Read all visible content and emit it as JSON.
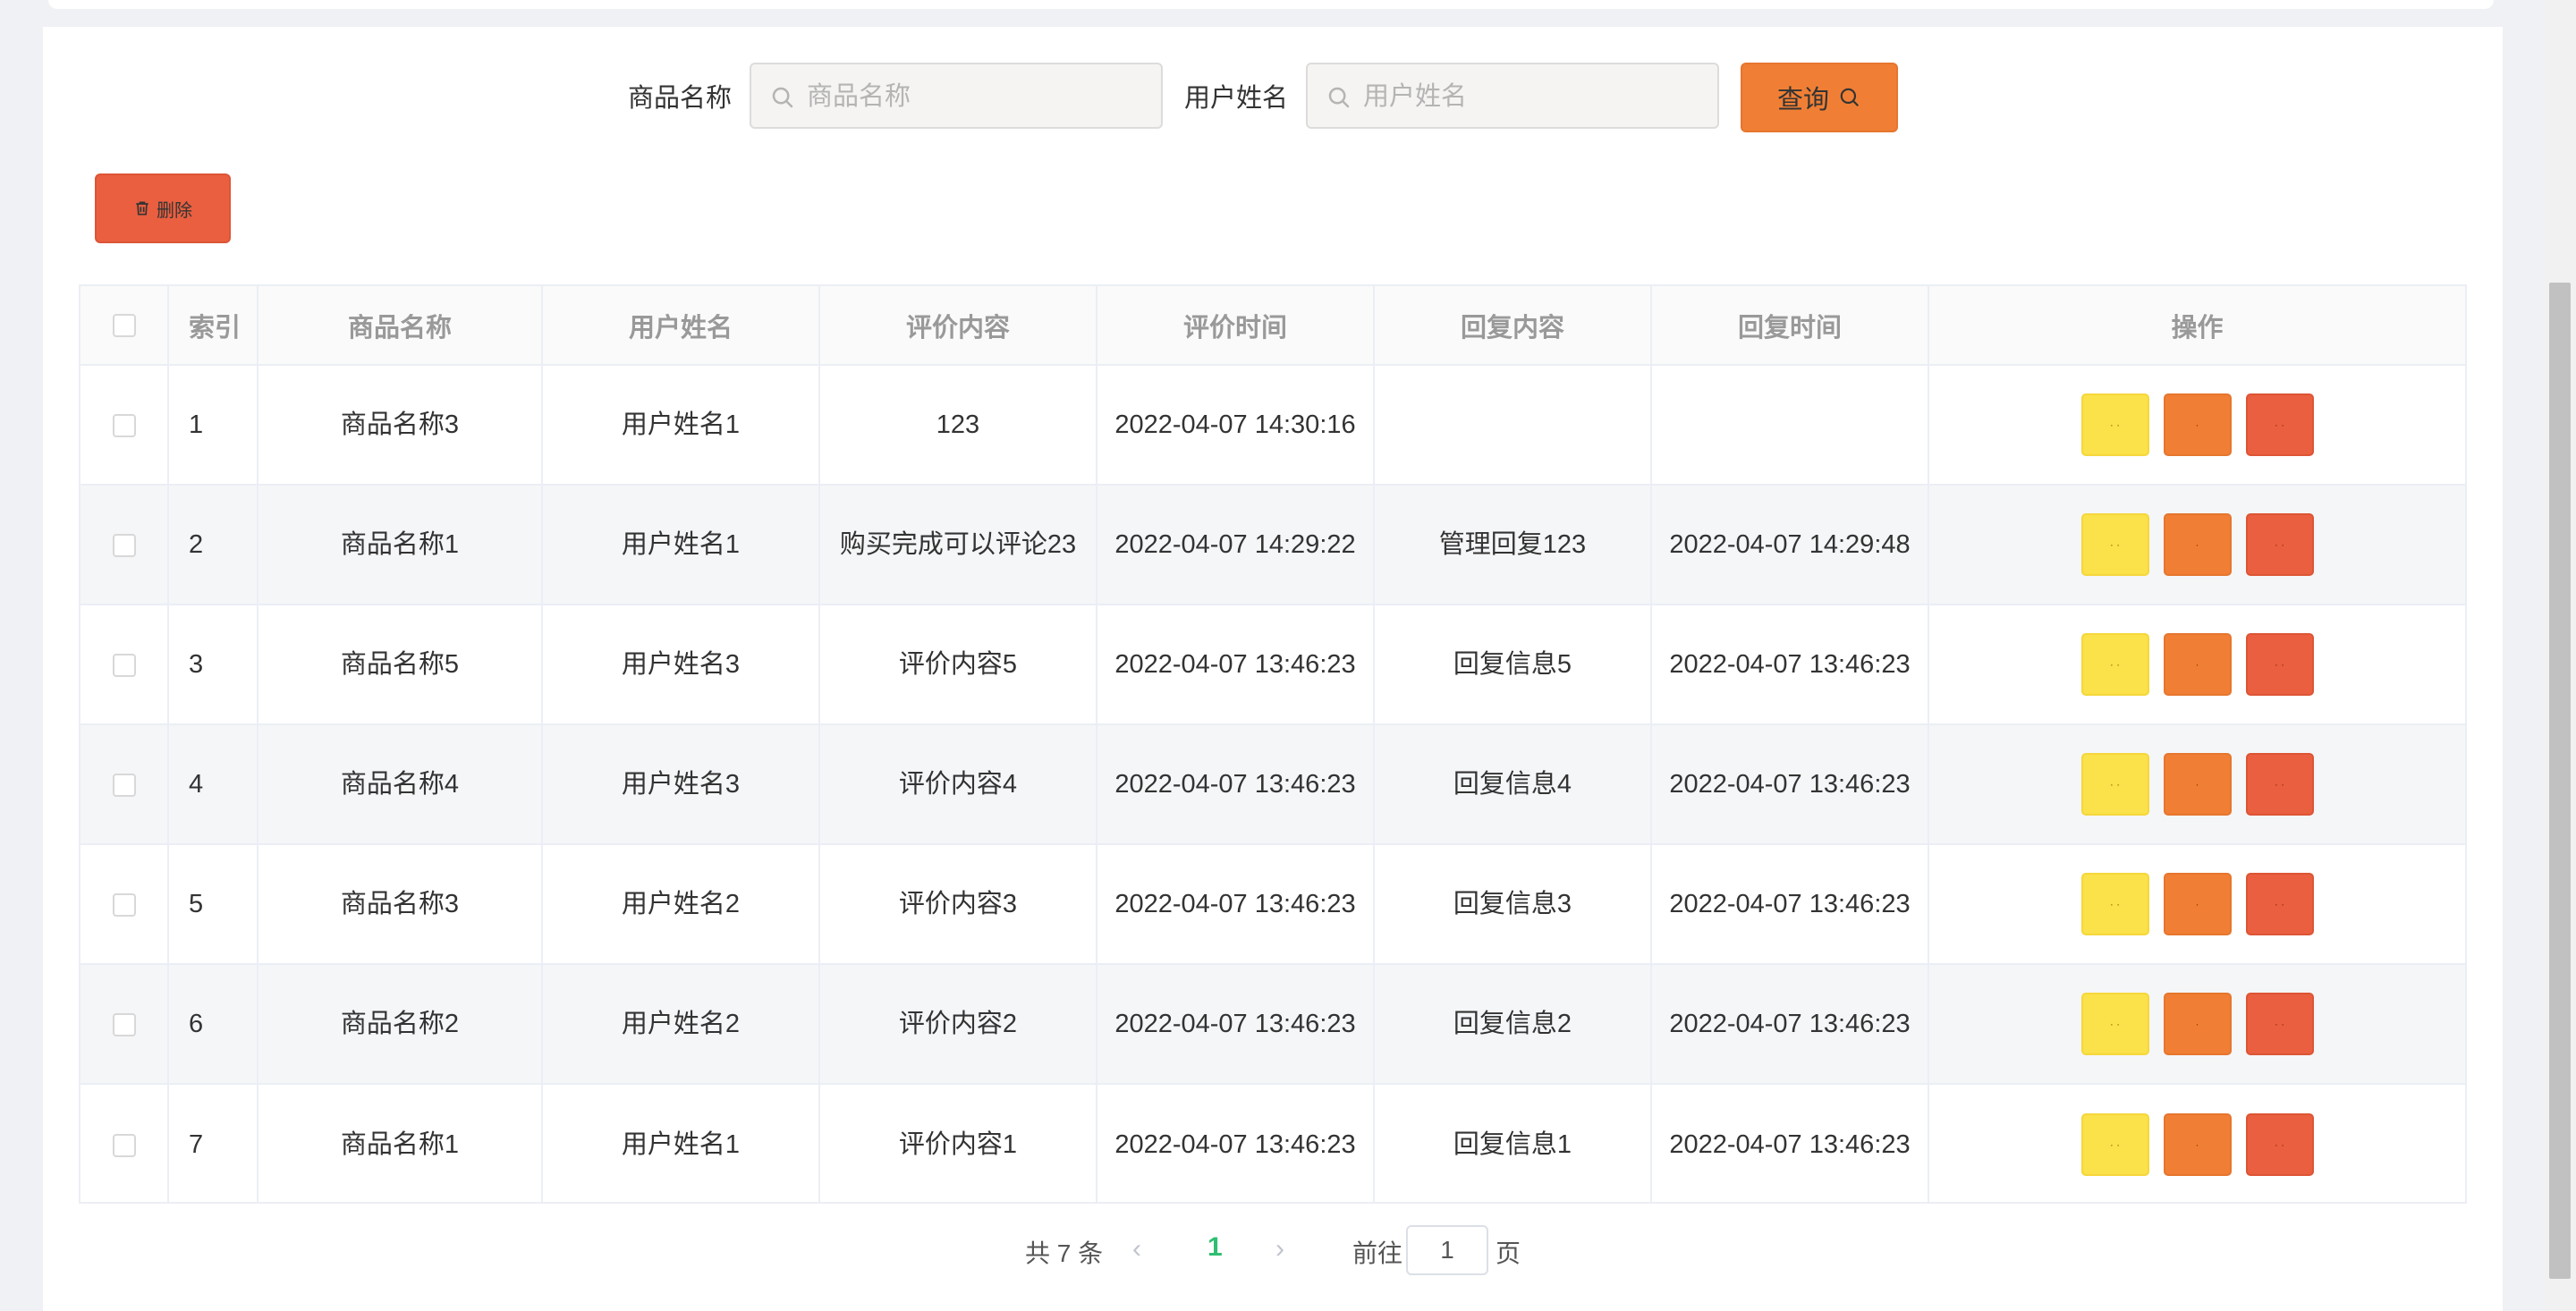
{
  "search": {
    "product_label": "商品名称",
    "product_placeholder": "商品名称",
    "product_value": "",
    "user_label": "用户姓名",
    "user_placeholder": "用户姓名",
    "user_value": "",
    "query_label": "查询"
  },
  "toolbar": {
    "delete_label": "删除"
  },
  "table": {
    "headers": [
      "",
      "索引",
      "商品名称",
      "用户姓名",
      "评价内容",
      "评价时间",
      "回复内容",
      "回复时间",
      "操作"
    ],
    "rows": [
      {
        "index": "1",
        "product": "商品名称3",
        "user": "用户姓名1",
        "content": "123",
        "time": "2022-04-07 14:30:16",
        "reply": "",
        "reply_time": ""
      },
      {
        "index": "2",
        "product": "商品名称1",
        "user": "用户姓名1",
        "content": "购买完成可以评论23",
        "time": "2022-04-07 14:29:22",
        "reply": "管理回复123",
        "reply_time": "2022-04-07 14:29:48"
      },
      {
        "index": "3",
        "product": "商品名称5",
        "user": "用户姓名3",
        "content": "评价内容5",
        "time": "2022-04-07 13:46:23",
        "reply": "回复信息5",
        "reply_time": "2022-04-07 13:46:23"
      },
      {
        "index": "4",
        "product": "商品名称4",
        "user": "用户姓名3",
        "content": "评价内容4",
        "time": "2022-04-07 13:46:23",
        "reply": "回复信息4",
        "reply_time": "2022-04-07 13:46:23"
      },
      {
        "index": "5",
        "product": "商品名称3",
        "user": "用户姓名2",
        "content": "评价内容3",
        "time": "2022-04-07 13:46:23",
        "reply": "回复信息3",
        "reply_time": "2022-04-07 13:46:23"
      },
      {
        "index": "6",
        "product": "商品名称2",
        "user": "用户姓名2",
        "content": "评价内容2",
        "time": "2022-04-07 13:46:23",
        "reply": "回复信息2",
        "reply_time": "2022-04-07 13:46:23"
      },
      {
        "index": "7",
        "product": "商品名称1",
        "user": "用户姓名1",
        "content": "评价内容1",
        "time": "2022-04-07 13:46:23",
        "reply": "回复信息1",
        "reply_time": "2022-04-07 13:46:23"
      }
    ]
  },
  "pagination": {
    "total_text": "共 7 条",
    "current_page": "1",
    "goto_label": "前往",
    "goto_value": "1",
    "unit_label": "页"
  },
  "colors": {
    "query_button": "#f07f35",
    "delete_button": "#e95f40",
    "op_yellow": "#fbe14a",
    "op_orange": "#f07f35",
    "op_red": "#e95f40",
    "active_page": "#2fbf71"
  },
  "icons": {
    "search_field": "search-icon",
    "query_button": "search-icon",
    "delete_button": "trash-icon",
    "prev": "chevron-left-icon",
    "next": "chevron-right-icon"
  }
}
